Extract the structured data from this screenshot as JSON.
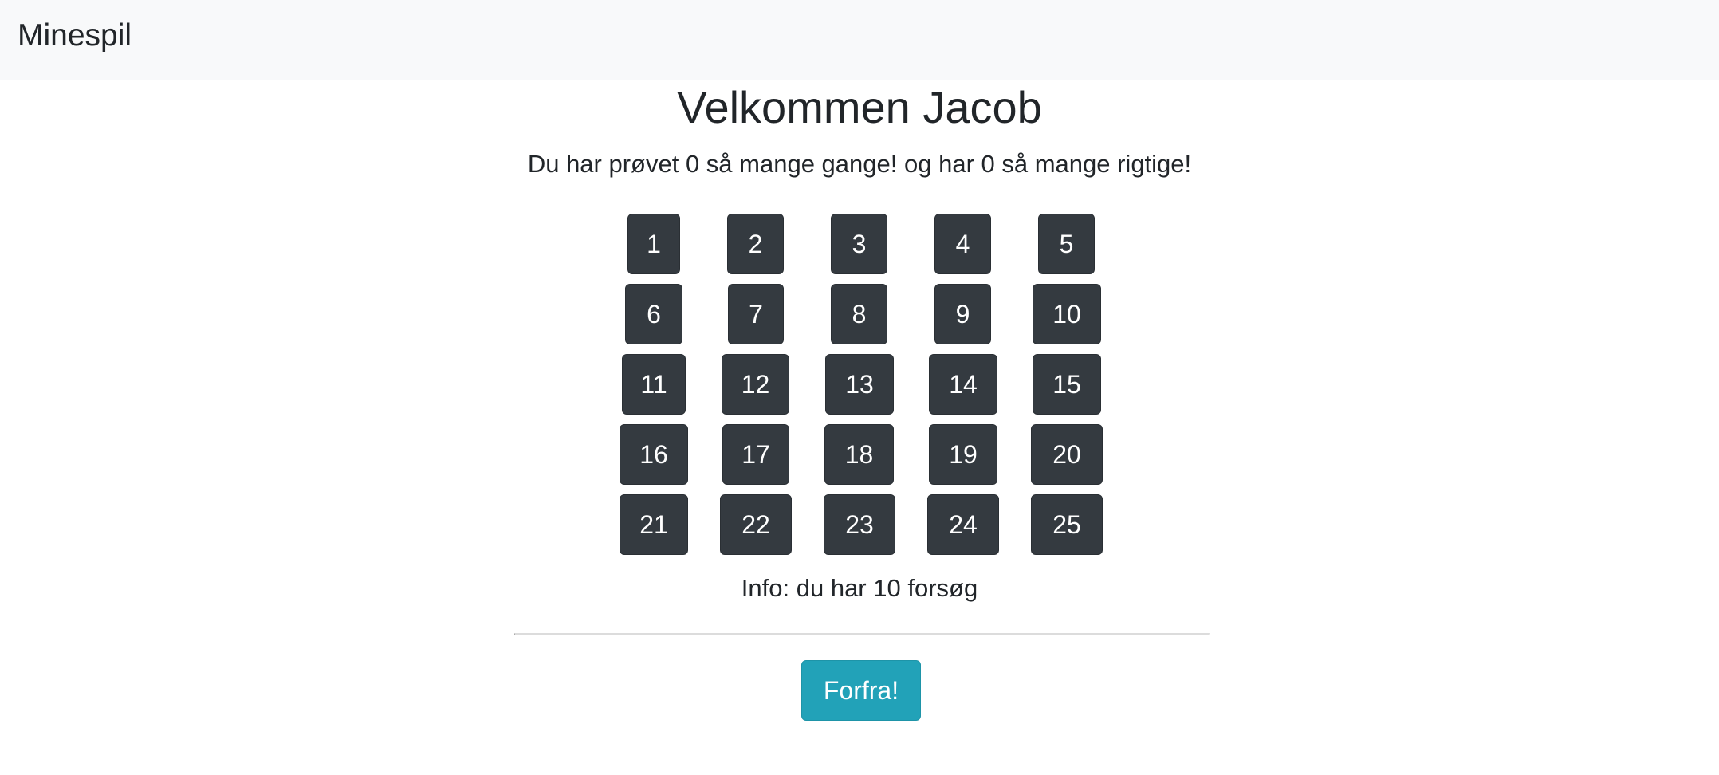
{
  "navbar": {
    "brand": "Minespil"
  },
  "main": {
    "title": "Velkommen Jacob",
    "subtitle": "Du har prøvet 0 så mange gange! og har 0 så mange rigtige!",
    "tiles": [
      "1",
      "2",
      "3",
      "4",
      "5",
      "6",
      "7",
      "8",
      "9",
      "10",
      "11",
      "12",
      "13",
      "14",
      "15",
      "16",
      "17",
      "18",
      "19",
      "20",
      "21",
      "22",
      "23",
      "24",
      "25"
    ],
    "info": "Info: du har 10 forsøg",
    "reset_label": "Forfra!"
  },
  "colors": {
    "navbar_bg": "#f8f9fa",
    "tile_bg": "#343a40",
    "reset_bg": "#22a2b8",
    "text": "#212529"
  }
}
